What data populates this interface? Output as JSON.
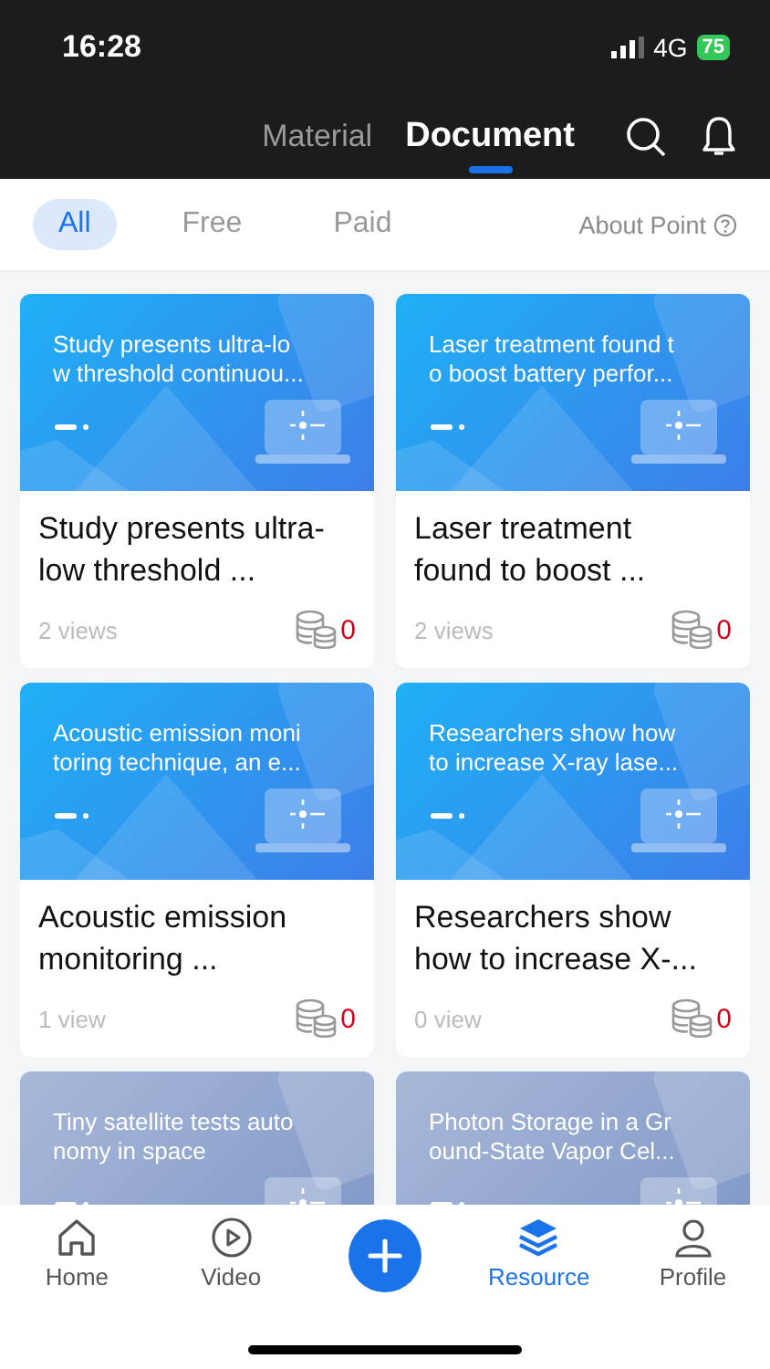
{
  "status_bar": {
    "time": "16:28",
    "network": "4G",
    "battery": "75"
  },
  "header": {
    "tabs": [
      {
        "label": "Material",
        "selected": false
      },
      {
        "label": "Document",
        "selected": true
      }
    ]
  },
  "filters": [
    {
      "label": "All",
      "selected": true
    },
    {
      "label": "Free",
      "selected": false
    },
    {
      "label": "Paid",
      "selected": false
    }
  ],
  "about_link": "About Point",
  "cards": [
    {
      "thumb_lines": [
        "Study presents ultra-lo",
        "w threshold continuou..."
      ],
      "title": "Study presents ultra-low threshold ...",
      "views": "2 views",
      "price": "0",
      "faded": false
    },
    {
      "thumb_lines": [
        "Laser treatment found t",
        "o boost battery perfor..."
      ],
      "title": "Laser treatment found to boost ...",
      "views": "2 views",
      "price": "0",
      "faded": false
    },
    {
      "thumb_lines": [
        "Acoustic emission moni",
        "toring technique, an e..."
      ],
      "title": "Acoustic emission monitoring ...",
      "views": "1 view",
      "price": "0",
      "faded": false
    },
    {
      "thumb_lines": [
        "Researchers show how",
        "to increase X-ray lase..."
      ],
      "title": "Researchers show how to increase X-...",
      "views": "0 view",
      "price": "0",
      "faded": false
    },
    {
      "thumb_lines": [
        "Tiny satellite tests auto",
        "nomy in space"
      ],
      "faded": true
    },
    {
      "thumb_lines": [
        "Photon Storage in a Gr",
        "ound-State Vapor Cel..."
      ],
      "faded": true
    }
  ],
  "tab_bar": [
    {
      "kind": "home",
      "label": "Home",
      "selected": false
    },
    {
      "kind": "video",
      "label": "Video",
      "selected": false
    },
    {
      "kind": "add",
      "selected": false
    },
    {
      "kind": "resource",
      "label": "Resource",
      "selected": true
    },
    {
      "kind": "profile",
      "label": "Profile",
      "selected": false
    }
  ]
}
